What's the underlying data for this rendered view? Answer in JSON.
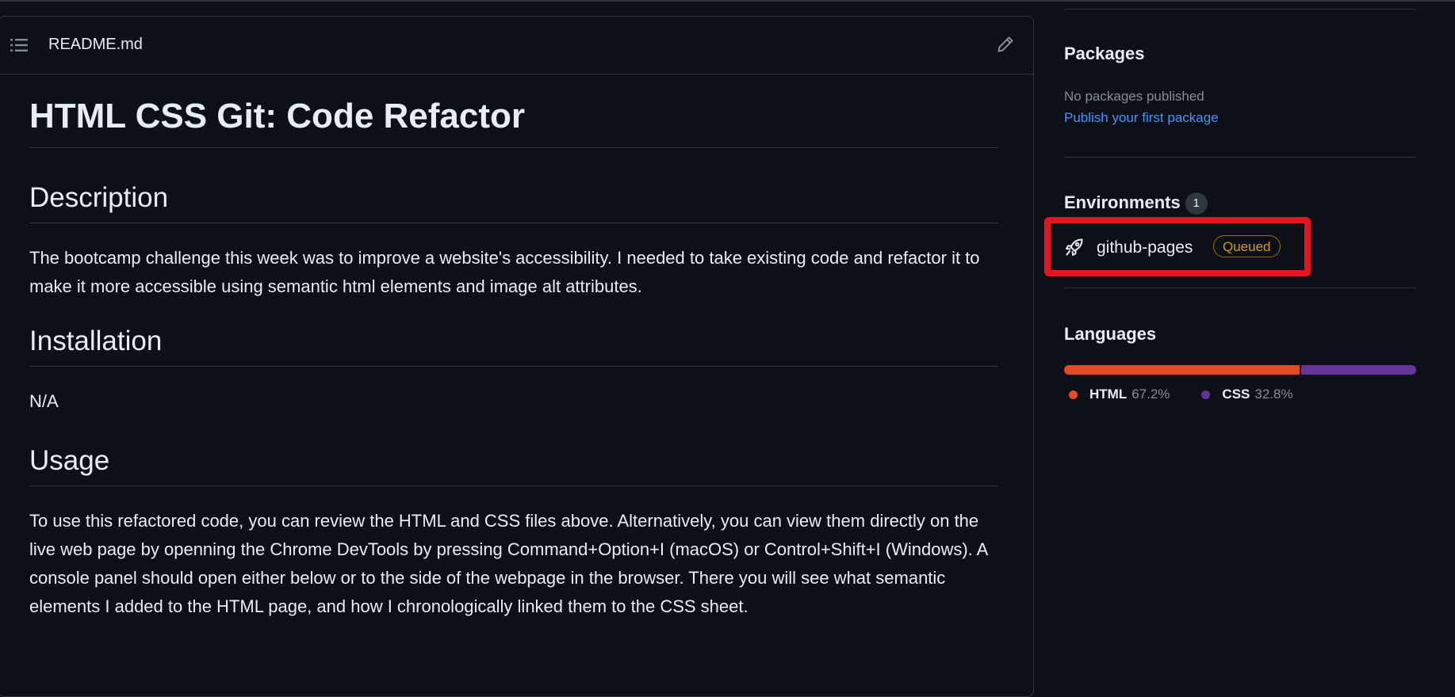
{
  "readme": {
    "filename": "README.md",
    "title": "HTML CSS Git: Code Refactor",
    "sections": {
      "description": {
        "heading": "Description",
        "text": "The bootcamp challenge this week was to improve a website's accessibility. I needed to take existing code and refactor it to make it more accessible using semantic html elements and image alt attributes."
      },
      "installation": {
        "heading": "Installation",
        "text": "N/A"
      },
      "usage": {
        "heading": "Usage",
        "text": "To use this refactored code, you can review the HTML and CSS files above. Alternatively, you can view them directly on the live web page by openning the Chrome DevTools by pressing Command+Option+I (macOS) or Control+Shift+I (Windows). A console panel should open either below or to the side of the webpage in the browser. There you will see what semantic elements I added to the HTML page, and how I chronologically linked them to the CSS sheet."
      }
    }
  },
  "sidebar": {
    "packages": {
      "title": "Packages",
      "empty_text": "No packages published",
      "publish_link": "Publish your first package"
    },
    "environments": {
      "title": "Environments",
      "count": "1",
      "items": [
        {
          "name": "github-pages",
          "status": "Queued",
          "icon": "rocket-icon"
        }
      ]
    },
    "languages": {
      "title": "Languages",
      "items": [
        {
          "name": "HTML",
          "percent": "67.2%",
          "value": 67.2,
          "color": "#e34c26"
        },
        {
          "name": "CSS",
          "percent": "32.8%",
          "value": 32.8,
          "color": "#663399"
        }
      ]
    }
  },
  "colors": {
    "background": "#0d1117",
    "border": "#30363d",
    "link": "#4493f8",
    "queued": "#d29922",
    "highlight": "#e4151f"
  }
}
